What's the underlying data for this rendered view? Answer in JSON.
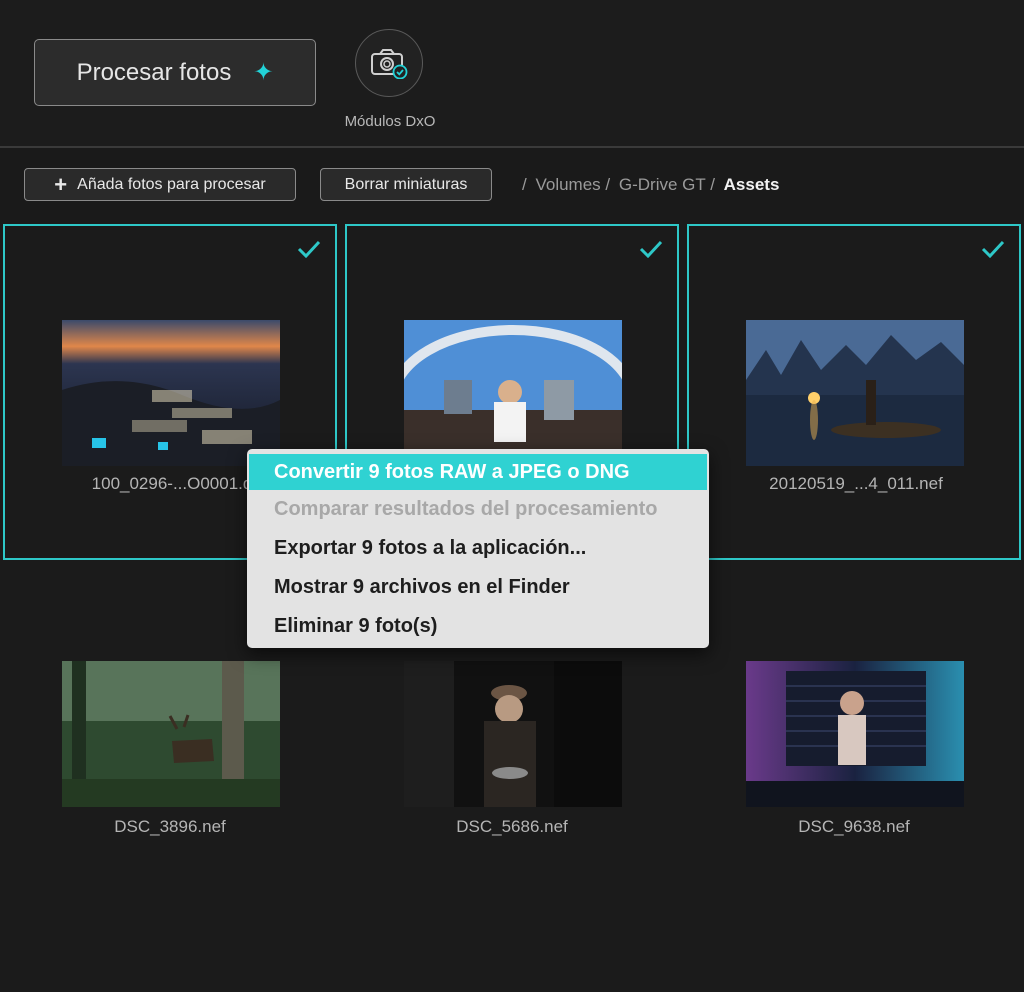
{
  "header": {
    "process_button_label": "Procesar fotos",
    "modules_label": "Módulos DxO"
  },
  "toolbar": {
    "add_photos_label": "Añada fotos para procesar",
    "clear_thumbnails_label": "Borrar miniaturas"
  },
  "breadcrumb": {
    "separator": "/",
    "items": [
      "Volumes",
      "G-Drive GT",
      "Assets"
    ]
  },
  "photos": [
    {
      "filename": "100_0296-...O0001.d",
      "selected": true
    },
    {
      "filename": "",
      "selected": true
    },
    {
      "filename": "20120519_...4_011.nef",
      "selected": true
    },
    {
      "filename": "DSC_3896.nef",
      "selected": false
    },
    {
      "filename": "DSC_5686.nef",
      "selected": false
    },
    {
      "filename": "DSC_9638.nef",
      "selected": false
    }
  ],
  "context_menu": {
    "items": [
      {
        "label": "Convertir 9 fotos RAW a JPEG o DNG",
        "state": "highlighted"
      },
      {
        "label": "Comparar resultados del procesamiento",
        "state": "disabled"
      },
      {
        "label": "Exportar 9 fotos a la aplicación...",
        "state": "enabled"
      },
      {
        "label": "Mostrar 9 archivos en el Finder",
        "state": "enabled"
      },
      {
        "label": "Eliminar 9 foto(s)",
        "state": "enabled"
      }
    ]
  },
  "colors": {
    "accent": "#2ec8c8",
    "background": "#1a1a1a",
    "menu_background": "#e3e3e3"
  }
}
